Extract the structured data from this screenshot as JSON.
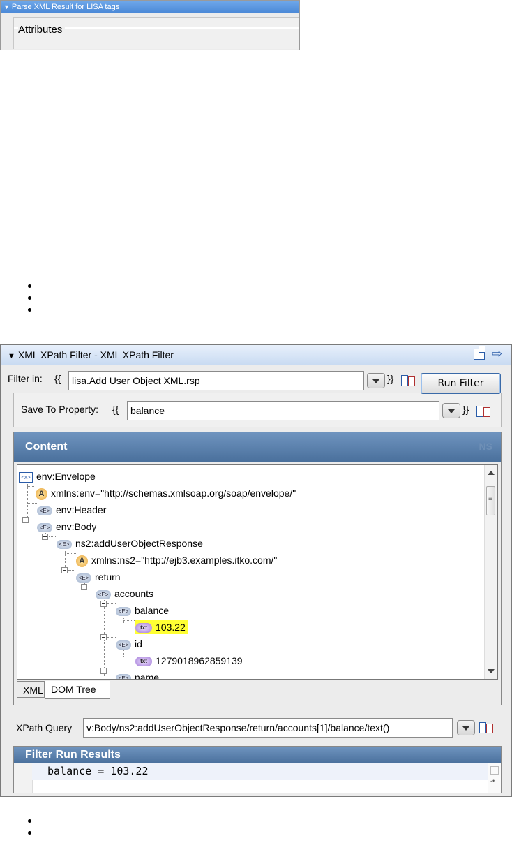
{
  "top_panel": {
    "header": "Parse XML Result for LISA tags",
    "attributes_label": "Attributes"
  },
  "main": {
    "header_title": "XML XPath Filter - XML XPath Filter",
    "filter_in_label": "Filter in:",
    "filter_in_value": "lisa.Add User Object XML.rsp",
    "open_braces": "{{",
    "close_braces": "}}",
    "run_filter_label": "Run Filter",
    "save_to_property_label": "Save To Property:",
    "save_to_property_value": "balance",
    "content_title": "Content",
    "ns_label": "NS",
    "tree": [
      {
        "icon": "root-icon",
        "icon_text": "<x>",
        "text": "env:Envelope"
      },
      {
        "icon": "attribute-icon",
        "icon_text": "A",
        "text": "xmlns:env=\"http://schemas.xmlsoap.org/soap/envelope/\""
      },
      {
        "icon": "element-icon",
        "icon_text": "<E>",
        "text": "env:Header"
      },
      {
        "icon": "element-icon",
        "icon_text": "<E>",
        "text": "env:Body"
      },
      {
        "icon": "element-icon",
        "icon_text": "<E>",
        "text": "ns2:addUserObjectResponse"
      },
      {
        "icon": "attribute-icon",
        "icon_text": "A",
        "text": "xmlns:ns2=\"http://ejb3.examples.itko.com/\""
      },
      {
        "icon": "element-icon",
        "icon_text": "<E>",
        "text": "return"
      },
      {
        "icon": "element-icon",
        "icon_text": "<E>",
        "text": "accounts"
      },
      {
        "icon": "element-icon",
        "icon_text": "<E>",
        "text": "balance"
      },
      {
        "icon": "text-icon",
        "icon_text": "txt",
        "text": "103.22",
        "highlighted": true
      },
      {
        "icon": "element-icon",
        "icon_text": "<E>",
        "text": "id"
      },
      {
        "icon": "text-icon",
        "icon_text": "txt",
        "text": "1279018962859139"
      },
      {
        "icon": "element-icon",
        "icon_text": "<E>",
        "text": "name"
      }
    ],
    "tabs": [
      "XML",
      "DOM Tree"
    ],
    "xpath_label": "XPath Query",
    "xpath_value": "v:Body/ns2:addUserObjectResponse/return/accounts[1]/balance/text()",
    "results_title": "Filter Run Results",
    "result_text": "balance = 103.22"
  }
}
